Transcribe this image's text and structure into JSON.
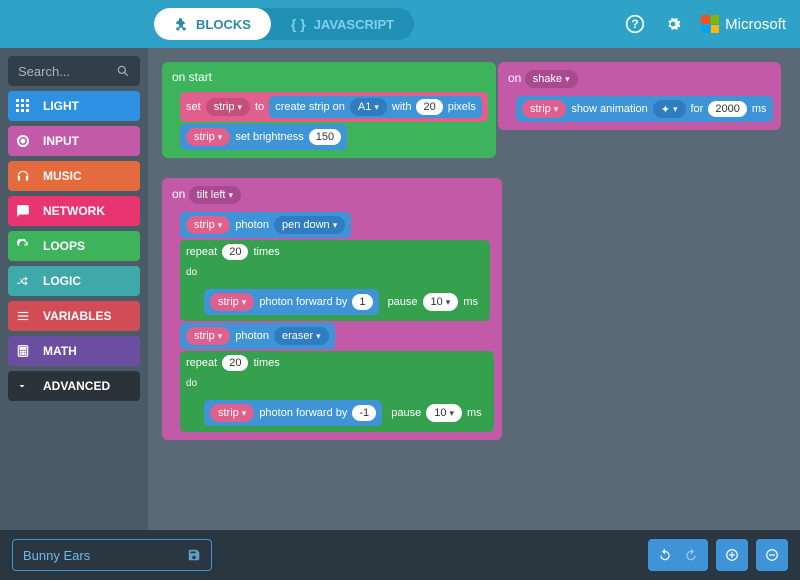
{
  "header": {
    "tab_blocks_label": "BLOCKS",
    "tab_js_label": "JAVASCRIPT",
    "brand": "Microsoft"
  },
  "sidebar": {
    "search_placeholder": "Search...",
    "categories": [
      {
        "id": "light",
        "label": "LIGHT",
        "color": "#2d90e0"
      },
      {
        "id": "input",
        "label": "INPUT",
        "color": "#c25aa8"
      },
      {
        "id": "music",
        "label": "MUSIC",
        "color": "#e56a3e"
      },
      {
        "id": "network",
        "label": "NETWORK",
        "color": "#e83571"
      },
      {
        "id": "loops",
        "label": "LOOPS",
        "color": "#3db35c"
      },
      {
        "id": "logic",
        "label": "LOGIC",
        "color": "#3fa8a8"
      },
      {
        "id": "variables",
        "label": "VARIABLES",
        "color": "#d14c54"
      },
      {
        "id": "math",
        "label": "MATH",
        "color": "#6b4ea0"
      }
    ],
    "advanced_label": "ADVANCED"
  },
  "workspace": {
    "onstart": {
      "title": "on start",
      "set_kw": "set",
      "strip_dd": "strip",
      "to_kw": "to",
      "create_strip": "create strip on",
      "pin_dd": "A1",
      "with_kw": "with",
      "pixels_val": "20",
      "pixels_kw": "pixels",
      "brightness_kw": "set brightness",
      "brightness_val": "150"
    },
    "onshake": {
      "on_kw": "on",
      "gesture_dd": "shake",
      "show_anim": "show animation",
      "anim_dd": "✦",
      "for_kw": "for",
      "dur_val": "2000",
      "ms_kw": "ms",
      "strip_dd": "strip"
    },
    "tiltleft": {
      "on_kw": "on",
      "event_dd": "tilt left",
      "strip_dd": "strip",
      "photon_kw": "photon",
      "pen_dd": "pen down",
      "repeat_kw": "repeat",
      "repeat_val": "20",
      "times_kw": "times",
      "do_kw": "do",
      "forward_kw": "photon forward by",
      "forward_val1": "1",
      "pause_kw": "pause",
      "pause_val": "10",
      "ms_kw": "ms",
      "eraser_dd": "eraser",
      "forward_val2": "-1"
    }
  },
  "footer": {
    "project_name": "Bunny Ears"
  }
}
